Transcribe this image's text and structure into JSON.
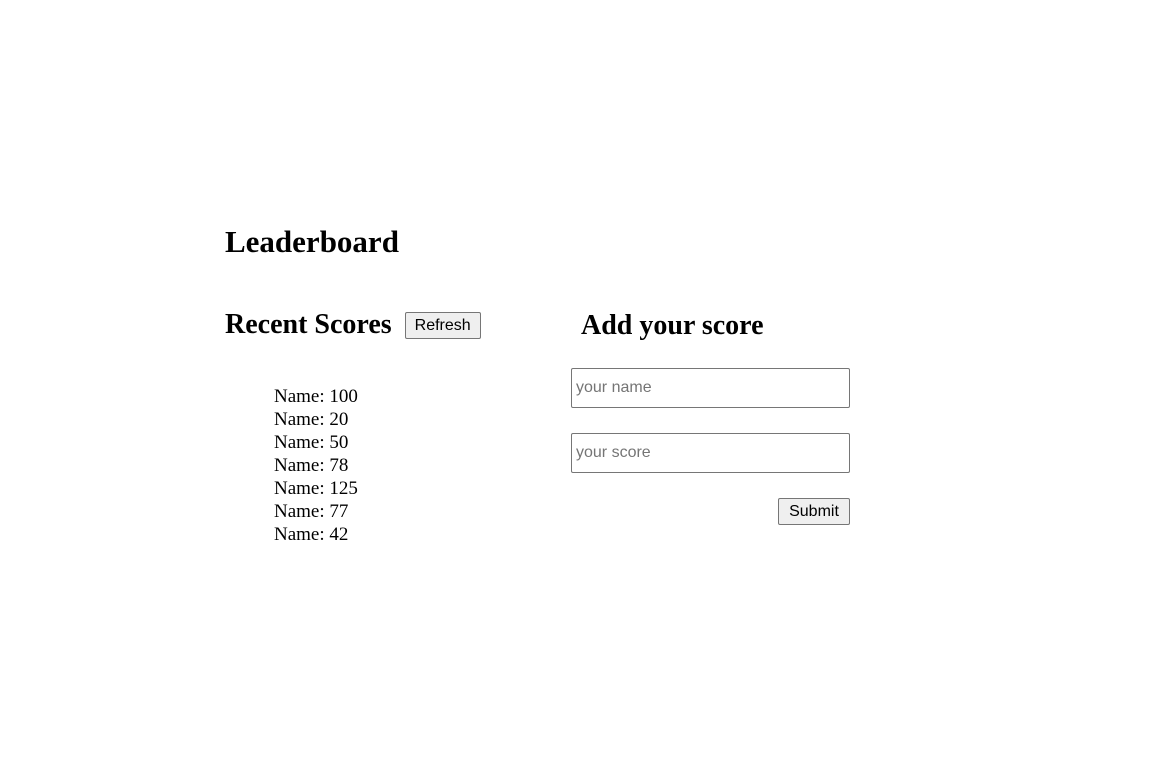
{
  "page": {
    "title": "Leaderboard"
  },
  "recent": {
    "heading": "Recent Scores",
    "refresh_label": "Refresh",
    "entries": [
      "Name: 100",
      "Name: 20",
      "Name: 50",
      "Name: 78",
      "Name: 125",
      "Name: 77",
      "Name: 42"
    ]
  },
  "form": {
    "heading": "Add your score",
    "name_placeholder": "your name",
    "score_placeholder": "your score",
    "submit_label": "Submit"
  }
}
